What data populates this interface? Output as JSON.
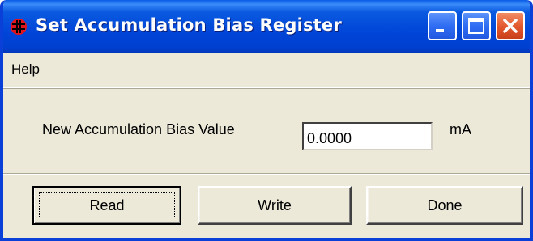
{
  "window": {
    "title": "Set Accumulation Bias Register",
    "icon": "app-logo-icon",
    "controls": [
      "minimize-icon",
      "maximize-icon",
      "close-icon"
    ],
    "colors": {
      "titlebar": "#0045d8",
      "close_button": "#e45a30",
      "face": "#ece9d8"
    }
  },
  "menu": {
    "items": [
      {
        "label": "Help"
      }
    ]
  },
  "form": {
    "label": "New Accumulation Bias Value",
    "value": "0.0000",
    "unit": "mA"
  },
  "buttons": {
    "read": "Read",
    "write": "Write",
    "done": "Done"
  }
}
